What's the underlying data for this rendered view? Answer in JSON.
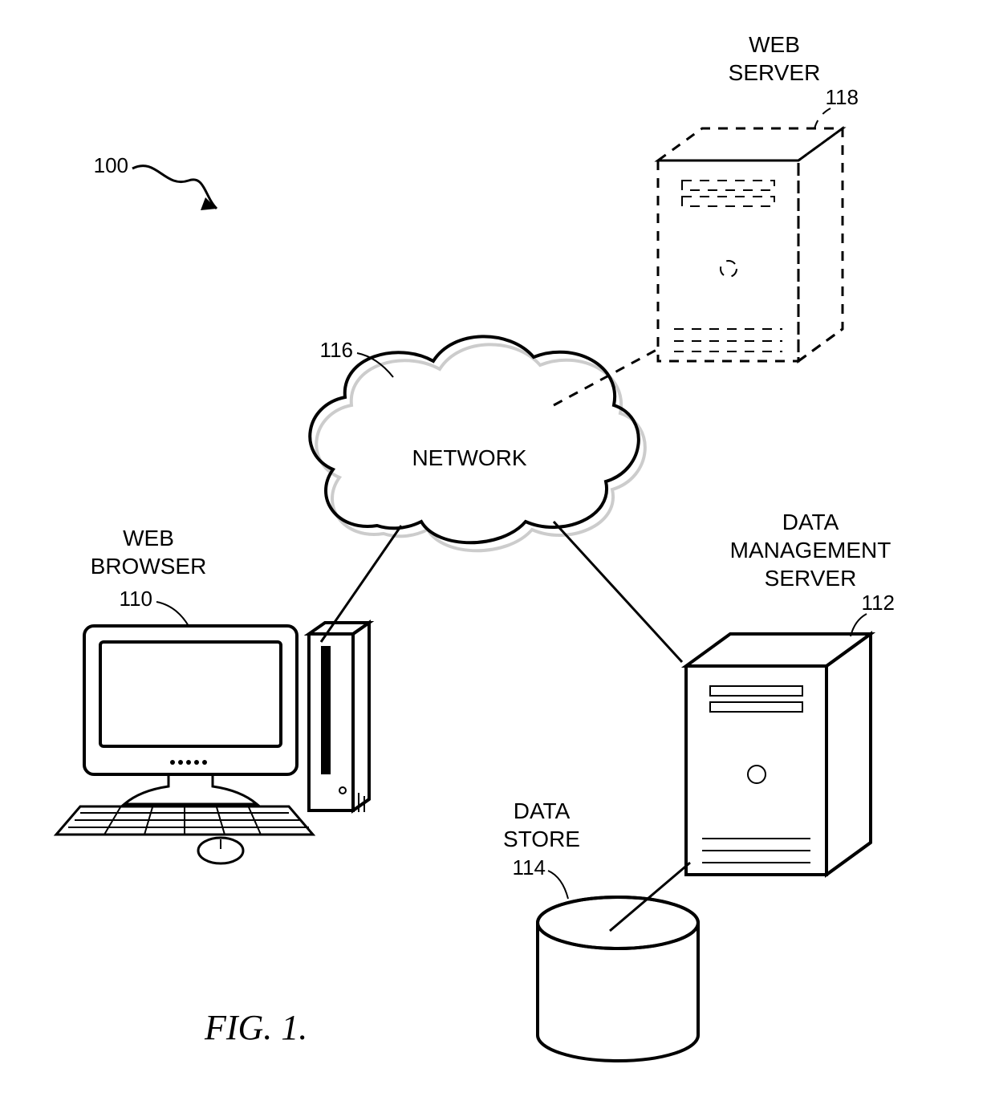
{
  "figure": {
    "caption": "FIG. 1."
  },
  "overall": {
    "ref": "100"
  },
  "network": {
    "label": "NETWORK",
    "ref": "116"
  },
  "web_server": {
    "label1": "WEB",
    "label2": "SERVER",
    "ref": "118"
  },
  "web_browser": {
    "label1": "WEB",
    "label2": "BROWSER",
    "ref": "110"
  },
  "dm_server": {
    "label1": "DATA",
    "label2": "MANAGEMENT",
    "label3": "SERVER",
    "ref": "112"
  },
  "data_store": {
    "label1": "DATA",
    "label2": "STORE",
    "ref": "114"
  }
}
